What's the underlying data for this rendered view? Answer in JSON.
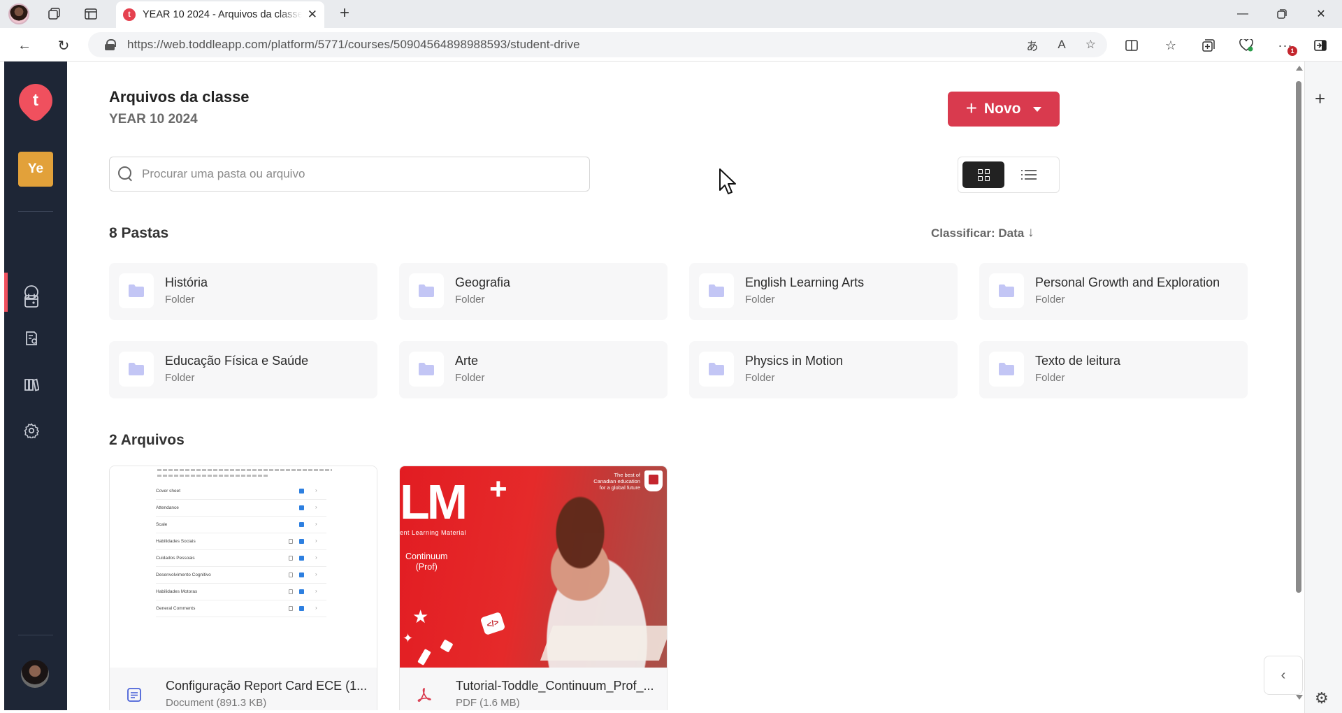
{
  "browser": {
    "tab_title": "YEAR 10 2024 - Arquivos da classe",
    "tab_favicon": "t",
    "url": "https://web.toddleapp.com/platform/5771/courses/50904564898988593/student-drive",
    "notification_count": "1"
  },
  "sidebar": {
    "logo_letter": "t",
    "class_badge": "Ye",
    "items": [
      {
        "name": "calendar-icon"
      },
      {
        "name": "chat-icon",
        "active": true
      },
      {
        "name": "assessment-icon"
      },
      {
        "name": "library-icon"
      },
      {
        "name": "settings-icon"
      }
    ]
  },
  "header": {
    "title": "Arquivos da classe",
    "subtitle": "YEAR 10 2024",
    "new_button": "Novo"
  },
  "search": {
    "placeholder": "Procurar uma pasta ou arquivo"
  },
  "folders_section": {
    "title": "8 Pastas",
    "sort_label": "Classificar: Data",
    "folders": [
      {
        "name": "História",
        "type": "Folder"
      },
      {
        "name": "Geografia",
        "type": "Folder"
      },
      {
        "name": "English Learning Arts",
        "type": "Folder"
      },
      {
        "name": "Personal Growth and Exploration",
        "type": "Folder"
      },
      {
        "name": "Educação Física e Saúde",
        "type": "Folder"
      },
      {
        "name": "Arte",
        "type": "Folder"
      },
      {
        "name": "Physics in Motion",
        "type": "Folder"
      },
      {
        "name": "Texto de leitura",
        "type": "Folder"
      }
    ]
  },
  "files_section": {
    "title": "2 Arquivos",
    "files": [
      {
        "name": "Configuração Report Card ECE (1...",
        "type": "Document (891.3 KB)",
        "icon": "document-icon"
      },
      {
        "name": "Tutorial-Toddle_Continuum_Prof_...",
        "type": "PDF (1.6 MB)",
        "icon": "pdf-icon"
      }
    ]
  },
  "doc_thumbnail": {
    "rows": [
      "Cover sheet",
      "Attendance",
      "Scale",
      "Habilidades Sociais",
      "Cuidados Pessoais",
      "Desenvolvimento Cognitivo",
      "Habilidades Motoras",
      "General Comments"
    ]
  },
  "pdf_thumbnail": {
    "logo": "LM",
    "plus": "+",
    "subtitle": "ent Learning Material",
    "continuum": "Continuum",
    "prof": "(Prof)",
    "tagline_1": "The best of",
    "tagline_2": "Canadian education",
    "tagline_3": "for a global future",
    "bubble": "</>"
  },
  "colors": {
    "accent": "#d93a4e",
    "nav_bg": "#1e2636",
    "folder_icon": "#c3c6f5",
    "class_badge": "#e2a13a"
  }
}
